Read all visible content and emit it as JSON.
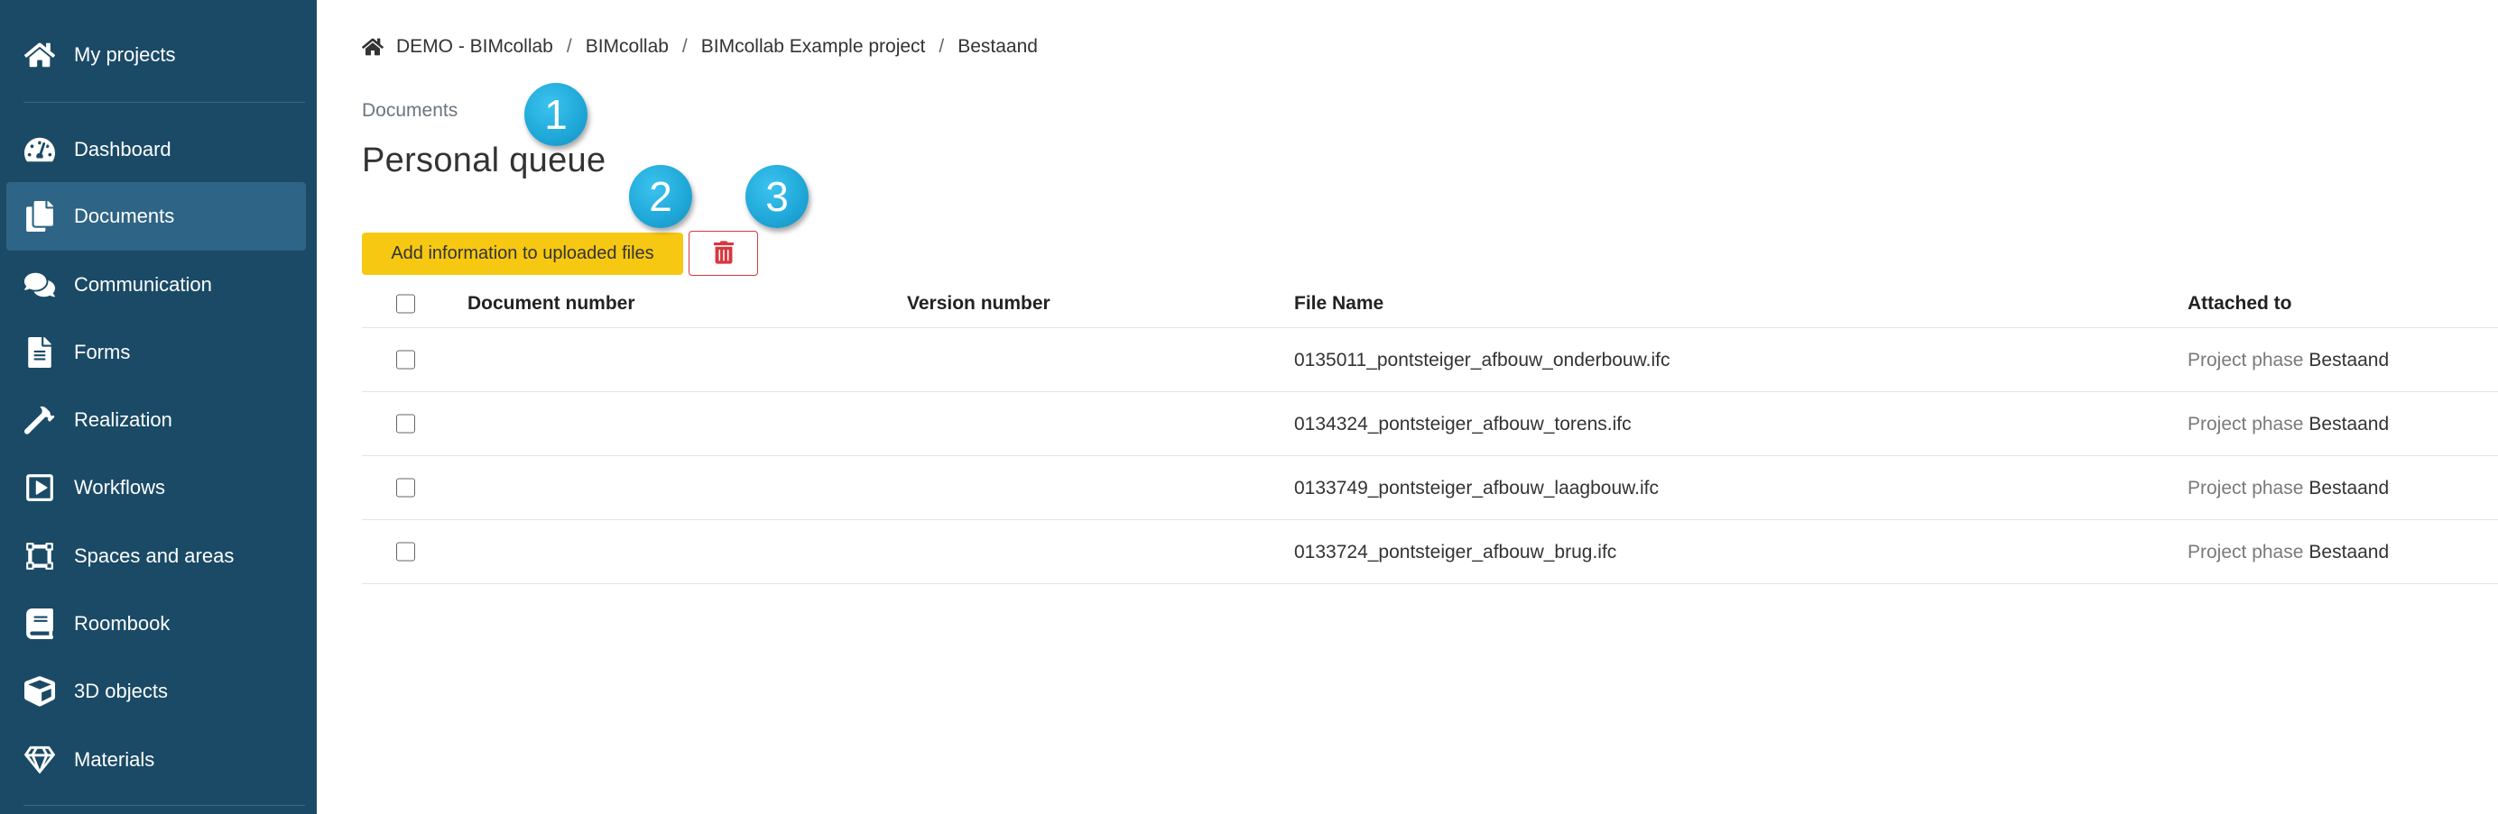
{
  "sidebar": {
    "top_item": {
      "label": "My projects",
      "icon": "home-icon"
    },
    "items": [
      {
        "label": "Dashboard",
        "icon": "dashboard-icon",
        "active": false
      },
      {
        "label": "Documents",
        "icon": "documents-icon",
        "active": true
      },
      {
        "label": "Communication",
        "icon": "comments-icon",
        "active": false
      },
      {
        "label": "Forms",
        "icon": "form-icon",
        "active": false
      },
      {
        "label": "Realization",
        "icon": "hammer-icon",
        "active": false
      },
      {
        "label": "Workflows",
        "icon": "play-square-icon",
        "active": false
      },
      {
        "label": "Spaces and areas",
        "icon": "vector-square-icon",
        "active": false
      },
      {
        "label": "Roombook",
        "icon": "book-icon",
        "active": false
      },
      {
        "label": "3D objects",
        "icon": "cube-icon",
        "active": false
      },
      {
        "label": "Materials",
        "icon": "gem-icon",
        "active": false
      }
    ]
  },
  "breadcrumb": {
    "items": [
      "DEMO - BIMcollab",
      "BIMcollab",
      "BIMcollab Example project",
      "Bestaand"
    ],
    "separator": "/"
  },
  "section_label": "Documents",
  "page_title": "Personal queue",
  "toolbar": {
    "add_label": "Add information to uploaded files",
    "delete_icon": "trash-icon"
  },
  "markers": [
    "1",
    "2",
    "3"
  ],
  "table": {
    "columns": [
      "Document number",
      "Version number",
      "File Name",
      "Attached to"
    ],
    "rows": [
      {
        "document_number": "",
        "version_number": "",
        "file_name": "0135011_pontsteiger_afbouw_onderbouw.ifc",
        "attached_prefix": "Project phase",
        "attached_value": "Bestaand"
      },
      {
        "document_number": "",
        "version_number": "",
        "file_name": "0134324_pontsteiger_afbouw_torens.ifc",
        "attached_prefix": "Project phase",
        "attached_value": "Bestaand"
      },
      {
        "document_number": "",
        "version_number": "",
        "file_name": "0133749_pontsteiger_afbouw_laagbouw.ifc",
        "attached_prefix": "Project phase",
        "attached_value": "Bestaand"
      },
      {
        "document_number": "",
        "version_number": "",
        "file_name": "0133724_pontsteiger_afbouw_brug.ifc",
        "attached_prefix": "Project phase",
        "attached_value": "Bestaand"
      }
    ]
  },
  "colors": {
    "sidebar_bg": "#1a4a66",
    "sidebar_active": "#2e6485",
    "primary_button": "#f6c812",
    "danger": "#d9363e",
    "marker": "#1ea7d8"
  }
}
